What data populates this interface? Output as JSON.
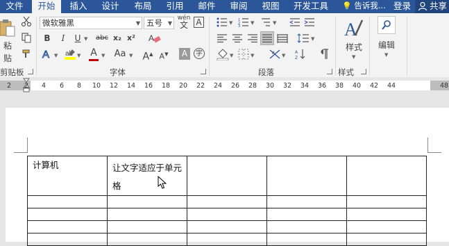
{
  "menu_tabs": {
    "file": "文件",
    "home": "开始",
    "insert": "插入",
    "design": "设计",
    "layout": "布局",
    "references": "引用",
    "mailings": "邮件",
    "review": "审阅",
    "view": "视图",
    "developer": "开发工具"
  },
  "tell_me": "告诉我...",
  "login": "登录",
  "share": "共享",
  "ribbon": {
    "clipboard": {
      "paste": "粘贴",
      "group": "剪贴板"
    },
    "font": {
      "name": "微软雅黑",
      "size": "五号",
      "bold": "B",
      "italic": "I",
      "underline": "U",
      "strike": "abc",
      "subscript": "x₂",
      "superscript": "x²",
      "font_color": "A",
      "case": "Aa",
      "grow": "A",
      "shrink": "A",
      "char_shade": "A",
      "enclose": "字",
      "phonetic": "wén",
      "border_char": "A",
      "group": "字体"
    },
    "paragraph": {
      "group": "段落"
    },
    "styles": {
      "label": "样式",
      "group": "样式"
    },
    "editing": {
      "label": "编辑"
    }
  },
  "ruler_numbers": [
    "2",
    "2",
    "4",
    "6",
    "8",
    "10",
    "12",
    "14",
    "16",
    "18",
    "20",
    "22",
    "24",
    "26",
    "28",
    "30",
    "32",
    "34",
    "36",
    "38",
    "40",
    "42",
    "44",
    "48"
  ],
  "table": {
    "rows": [
      [
        "计算机",
        "让文字适应于单元格",
        "",
        "",
        ""
      ],
      [
        "",
        "",
        "",
        "",
        ""
      ],
      [
        "",
        "",
        "",
        "",
        ""
      ],
      [
        "",
        "",
        "",
        "",
        ""
      ],
      [
        "",
        "",
        "",
        "",
        ""
      ]
    ]
  },
  "colors": {
    "accent": "#2b579a",
    "highlight": "#ffff00",
    "font_color": "#c00000"
  }
}
